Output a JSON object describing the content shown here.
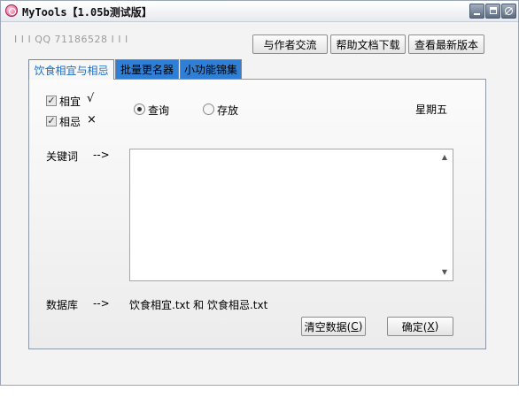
{
  "window": {
    "title": "MyTools【1.05b测试版】"
  },
  "header": {
    "qq_line": "I I I   QQ 71186528  I I I",
    "buttons": {
      "author": "与作者交流",
      "help": "帮助文档下载",
      "latest": "查看最新版本"
    }
  },
  "tabs": [
    {
      "label": "饮食相宜与相忌",
      "active": true
    },
    {
      "label": "批量更名器",
      "active": false
    },
    {
      "label": "小功能锦集",
      "active": false
    }
  ],
  "options": {
    "suitable_label": "相宜",
    "suitable_mark": "√",
    "suitable_checked": true,
    "avoid_label": "相忌",
    "avoid_mark": "×",
    "avoid_checked": true,
    "query_label": "查询",
    "store_label": "存放",
    "selected_mode": "查询",
    "weekday": "星期五"
  },
  "keyword": {
    "label": "关键词",
    "arrow": "-->",
    "value": ""
  },
  "database": {
    "label": "数据库",
    "arrow": "-->",
    "files": "饮食相宜.txt 和 饮食相忌.txt"
  },
  "actions": {
    "clear_text": "清空数据(",
    "clear_key": "C",
    "ok_text": "确定(",
    "ok_key": "X",
    "close_paren": ")"
  },
  "colors": {
    "tab_active_text": "#1a6fc5",
    "tab_inactive_bg": "#2f7fd6"
  }
}
